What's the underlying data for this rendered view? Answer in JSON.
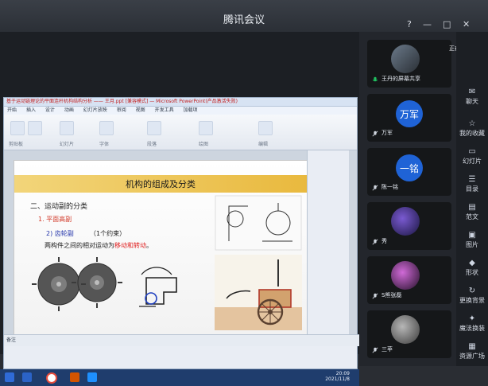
{
  "window": {
    "title": "腾讯会议",
    "controls": [
      "?",
      "—",
      "□",
      "✕"
    ]
  },
  "ppt": {
    "titlebar": "基于运动链理论的平面连杆机构结构分析 —— 王月.ppt [兼容模式] — Microsoft PowerPoint(产品激活失败)",
    "tabs": [
      "开始",
      "插入",
      "设计",
      "动画",
      "幻灯片放映",
      "审阅",
      "视图",
      "开发工具",
      "加载项"
    ],
    "ribbon_groups": [
      "剪贴板",
      "幻灯片",
      "字体",
      "段落",
      "绘图",
      "编辑"
    ],
    "status": "备注"
  },
  "slide": {
    "title": "机构的组成及分类",
    "h1": "二、运动副的分类",
    "h2": "1. 平面高副",
    "h3": "2) 齿轮副",
    "h3b": "（1个约束）",
    "p1_prefix": "两构件之间的相对运动为",
    "p1_highlight": "移动和转动",
    "p1_suffix": "。"
  },
  "taskbar": {
    "clock_time": "20:09",
    "clock_date": "2021/11/8"
  },
  "participants": [
    {
      "name": "王丹的屏幕共享",
      "avatar_text": "",
      "color": "#1f63d6"
    },
    {
      "name": "万军",
      "avatar_text": "万军",
      "color": "#1f63d6"
    },
    {
      "name": "陈一铭",
      "avatar_text": "一铭",
      "color": "#1f63d6"
    },
    {
      "name": "秀",
      "avatar_text": "",
      "color": "#7b4ab6"
    },
    {
      "name": "S熊张磊",
      "avatar_text": "",
      "color": "#6a3b7b"
    },
    {
      "name": "三苹",
      "avatar_text": "",
      "color": "#6a6a6a"
    }
  ],
  "banner": {
    "text": "正在讲话：王丹"
  },
  "sidebar": {
    "items": [
      {
        "label": "聊天",
        "icon": "chat-icon"
      },
      {
        "label": "我的收藏",
        "icon": "bookmark-icon"
      },
      {
        "label": "幻灯片",
        "icon": "slides-icon"
      },
      {
        "label": "目录",
        "icon": "list-icon"
      },
      {
        "label": "范文",
        "icon": "doc-icon"
      },
      {
        "label": "图片",
        "icon": "image-icon"
      },
      {
        "label": "形状",
        "icon": "shape-icon"
      },
      {
        "label": "更换背景",
        "icon": "refresh-icon"
      },
      {
        "label": "魔法换装",
        "icon": "magic-icon"
      },
      {
        "label": "资源广场",
        "icon": "grid-icon"
      }
    ]
  }
}
